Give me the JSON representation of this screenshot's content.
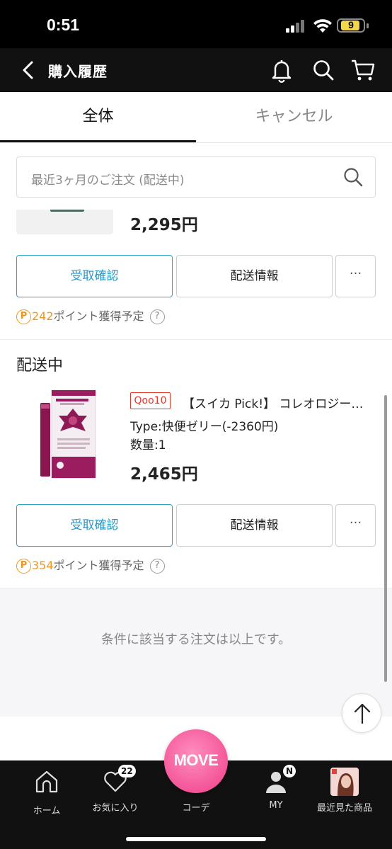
{
  "status_bar": {
    "time": "0:51",
    "battery": "9"
  },
  "header": {
    "title": "購入履歴"
  },
  "tabs": [
    {
      "label": "全体",
      "active": true
    },
    {
      "label": "キャンセル",
      "active": false
    }
  ],
  "search": {
    "placeholder": "最近3ヶ月のご注文 (配送中)"
  },
  "orders": [
    {
      "price": "2,295円",
      "buttons": {
        "primary": "受取確認",
        "secondary": "配送情報",
        "more": "···"
      },
      "points": {
        "amount": "242",
        "text": "ポイント獲得予定",
        "badge": "P",
        "help": "?"
      }
    },
    {
      "status": "配送中",
      "shop_tag": "Qoo10",
      "name": "【スイカ Pick!】 コレオロジーカラーゼリー",
      "option": "Type:快便ゼリー(-2360円)",
      "quantity": "数量:1",
      "price": "2,465円",
      "buttons": {
        "primary": "受取確認",
        "secondary": "配送情報",
        "more": "···"
      },
      "points": {
        "amount": "354",
        "text": "ポイント獲得予定",
        "badge": "P",
        "help": "?"
      }
    }
  ],
  "end_message": "条件に該当する注文は以上です。",
  "tabbar": {
    "items": [
      {
        "label": "ホーム",
        "icon": "home-icon"
      },
      {
        "label": "お気に入り",
        "icon": "heart-icon",
        "badge": "22"
      },
      {
        "label": "コーデ",
        "icon": "move-icon"
      },
      {
        "label": "MY",
        "icon": "person-icon",
        "badge": "N"
      },
      {
        "label": "最近見た商品",
        "icon": "recent-product-thumbnail"
      }
    ],
    "center_button": "MOVE"
  },
  "colors": {
    "accent_blue": "#2698c6",
    "point_orange": "#f0961e",
    "shop_red": "#e5362a",
    "move_pink": "#f45598"
  }
}
